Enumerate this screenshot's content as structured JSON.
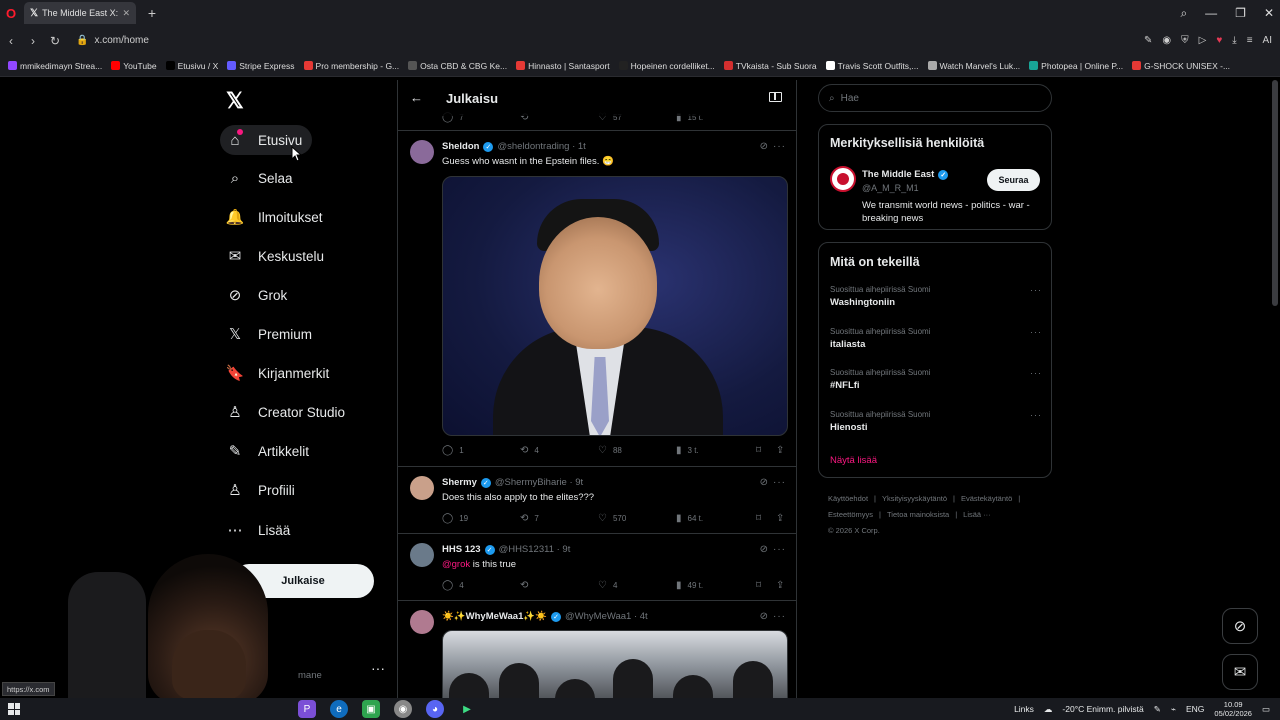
{
  "browser": {
    "tab_title": "The Middle East X:ssä: \"...",
    "url": "x.com/home",
    "bookmarks": [
      {
        "label": "mmikedimayn Strea...",
        "color": "#9147ff"
      },
      {
        "label": "YouTube",
        "color": "#ff0000"
      },
      {
        "label": "Etusivu / X",
        "color": "#000000"
      },
      {
        "label": "Stripe Express",
        "color": "#635bff"
      },
      {
        "label": "Pro membership - G...",
        "color": "#e53935"
      },
      {
        "label": "Osta CBD & CBG Ke...",
        "color": "#555555"
      },
      {
        "label": "Hinnasto | Santasport",
        "color": "#e53935"
      },
      {
        "label": "Hopeinen cordelliket...",
        "color": "#222222"
      },
      {
        "label": "TVkaista - Sub Suora",
        "color": "#d32f2f"
      },
      {
        "label": "Travis Scott Outfits,...",
        "color": "#ffffff"
      },
      {
        "label": "Watch Marvel's Luk...",
        "color": "#aaaaaa"
      },
      {
        "label": "Photopea | Online P...",
        "color": "#18a497"
      },
      {
        "label": "G-SHOCK UNISEX -...",
        "color": "#e53935"
      }
    ]
  },
  "nav": {
    "items": [
      {
        "label": "Etusivu",
        "icon": "home-icon",
        "glyph": "⌂",
        "active": true
      },
      {
        "label": "Selaa",
        "icon": "search-icon",
        "glyph": "⌕"
      },
      {
        "label": "Ilmoitukset",
        "icon": "bell-icon",
        "glyph": "🔔"
      },
      {
        "label": "Keskustelu",
        "icon": "mail-icon",
        "glyph": "✉"
      },
      {
        "label": "Grok",
        "icon": "grok-icon",
        "glyph": "⊘"
      },
      {
        "label": "Premium",
        "icon": "x-premium-icon",
        "glyph": "𝕏"
      },
      {
        "label": "Kirjanmerkit",
        "icon": "bookmark-icon",
        "glyph": "🔖"
      },
      {
        "label": "Creator Studio",
        "icon": "creator-icon",
        "glyph": "♙"
      },
      {
        "label": "Artikkelit",
        "icon": "articles-icon",
        "glyph": "✎"
      },
      {
        "label": "Profiili",
        "icon": "profile-icon",
        "glyph": "♙"
      },
      {
        "label": "Lisää",
        "icon": "more-icon",
        "glyph": "⋯"
      }
    ],
    "post_button": "Julkaise",
    "account_handle": "mane"
  },
  "center": {
    "title": "Julkaisu",
    "top_partial_actions": {
      "replies": "7",
      "reposts": "",
      "likes": "57",
      "views": "15 t."
    },
    "posts": [
      {
        "author": "Sheldon",
        "handle": "@sheldontrading · 1t",
        "text": "Guess who wasnt in the Epstein files. 😁",
        "replies": "1",
        "reposts": "4",
        "likes": "88",
        "views": "3 t.",
        "avatar_color": "#8a6a9a"
      },
      {
        "author": "Shermy",
        "handle": "@ShermyBiharie · 9t",
        "text": "Does this also apply to the elites???",
        "replies": "19",
        "reposts": "7",
        "likes": "570",
        "views": "64 t.",
        "avatar_color": "#c9a08a"
      },
      {
        "author": "HHS 123",
        "handle": "@HHS12311 · 9t",
        "mention": "@grok",
        "text": " is this true",
        "replies": "4",
        "reposts": "",
        "likes": "4",
        "views": "49 t.",
        "avatar_color": "#6a7a8a"
      },
      {
        "author": "☀️✨WhyMeWaa1✨☀️",
        "handle": "@WhyMeWaa1 · 4t",
        "avatar_color": "#b07a90"
      }
    ]
  },
  "right": {
    "search_placeholder": "Hae",
    "relevant": {
      "title": "Merkityksellisiä henkilöitä",
      "name": "The Middle East",
      "handle": "@A_M_R_M1",
      "bio": "We transmit world news - politics - war - breaking news",
      "follow": "Seuraa"
    },
    "trends": {
      "title": "Mitä on tekeillä",
      "items": [
        {
          "context": "Suosittua aihepiirissä Suomi",
          "name": "Washingtoniin"
        },
        {
          "context": "Suosittua aihepiirissä Suomi",
          "name": "italiasta"
        },
        {
          "context": "Suosittua aihepiirissä Suomi",
          "name": "#NFLfi"
        },
        {
          "context": "Suosittua aihepiirissä Suomi",
          "name": "Hienosti"
        }
      ],
      "show_more": "Näytä lisää"
    },
    "footer": [
      "Käyttöehdot",
      "|",
      "Yksityisyyskäytäntö",
      "|",
      "Evästekäytäntö",
      "|",
      "Esteettömyys",
      "|",
      "Tietoa mainoksista",
      "|",
      "Lisää ···",
      "© 2026 X Corp."
    ]
  },
  "taskbar": {
    "status_url": "https://x.com",
    "links": "Links",
    "weather": "-20°C  Enimm. pilvistä",
    "lang": "ENG",
    "time": "10.09",
    "date": "05/02/2026"
  }
}
